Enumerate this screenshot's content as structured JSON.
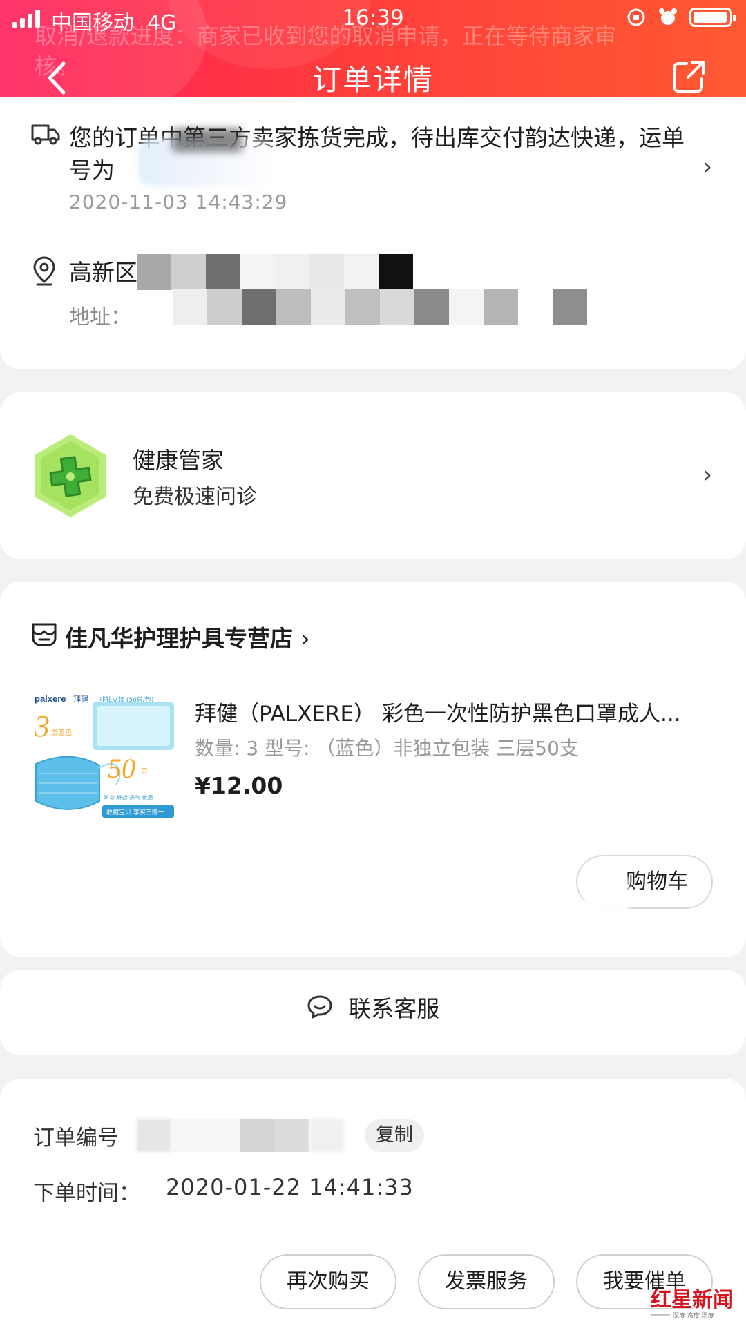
{
  "status_bar": {
    "carrier": "中国移动",
    "network": "4G",
    "time": "16:39",
    "battery_level": 0.95
  },
  "header": {
    "notice": "取消/退款进度：商家已收到您的取消申请，正在等待商家审核。",
    "title": "订单详情"
  },
  "logistics": {
    "message": "您的订单中第三方卖家拣货完成，待出库交付韵达快递，运单号为",
    "timestamp": "2020-11-03 14:43:29",
    "address_title": "高新区",
    "address_label": "地址："
  },
  "health": {
    "title": "健康管家",
    "subtitle": "免费极速问诊"
  },
  "store": {
    "name": "佳凡华护理护具专营店",
    "product": {
      "title": "拜健（PALXERE） 彩色一次性防护黑色口罩成人...",
      "spec": "数量: 3  型号: （蓝色）非独立包装 三层50支",
      "price": "¥12.00",
      "image": {
        "brand": "palxere",
        "brand_cn": "拜健",
        "layer_number": "3",
        "layer_label": "层蓝色",
        "pack_label": "非独立装 (50只/包)",
        "count": "50",
        "count_unit": "只",
        "slogan": "防尘 舒适 透气 优质",
        "footer": "收藏宝贝 享买三赠一"
      }
    },
    "cart_button": "购物车"
  },
  "service": {
    "label": "联系客服"
  },
  "order": {
    "number_label": "订单编号",
    "copy_label": "复制",
    "time_label": "下单时间：",
    "time_value": "2020-01-22 14:41:33"
  },
  "actions": {
    "buy_again": "再次购买",
    "invoice": "发票服务",
    "urge": "我要催单"
  },
  "watermark": {
    "text": "红星新闻",
    "tagline": "深度 态度 温度"
  }
}
